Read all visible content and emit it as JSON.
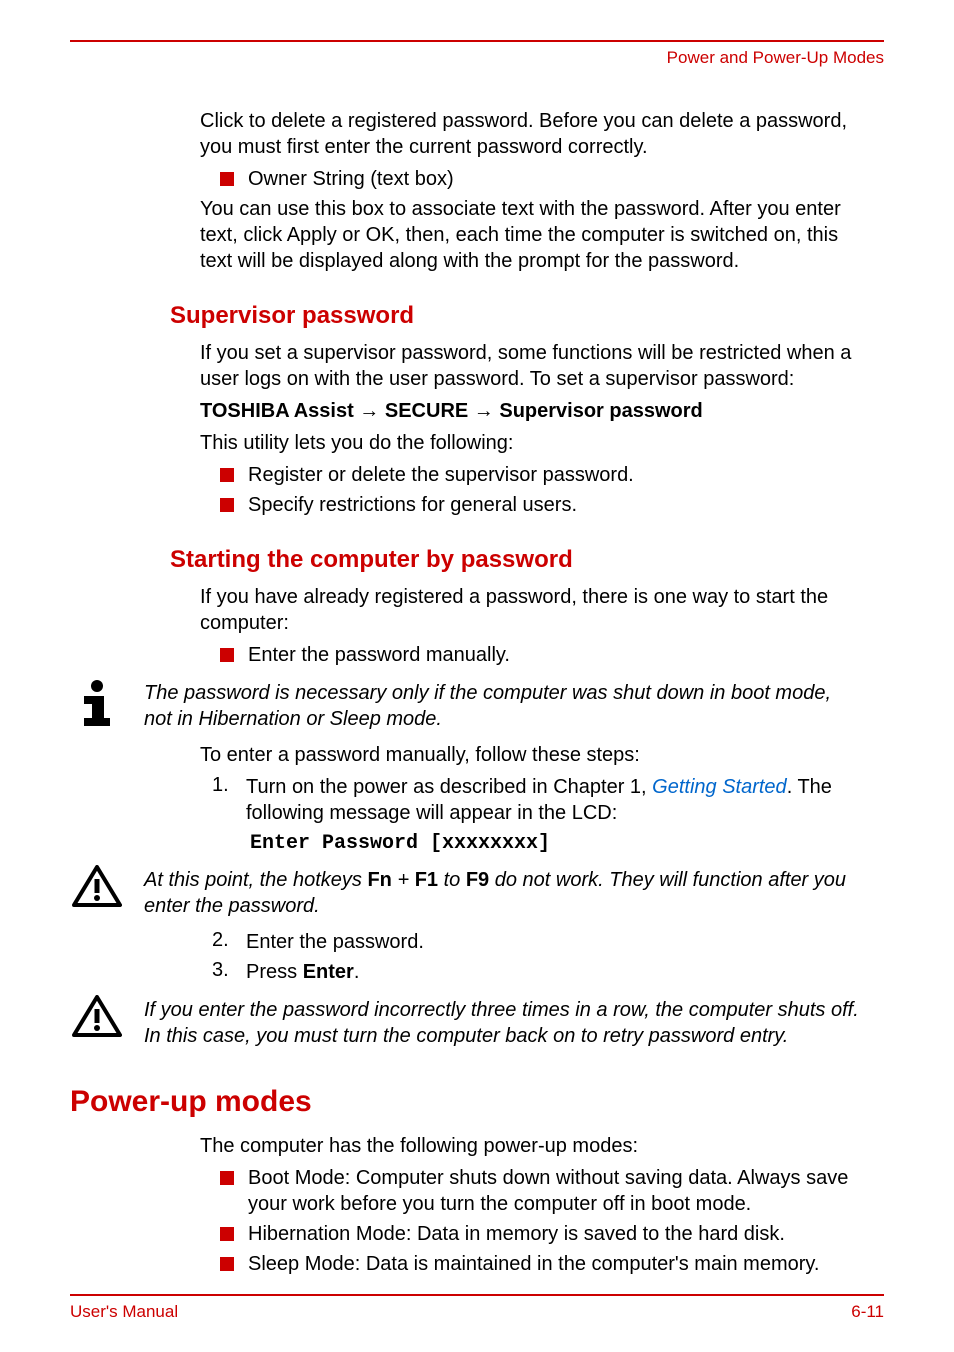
{
  "header": {
    "title": "Power and Power-Up Modes"
  },
  "intro": {
    "p1": "Click to delete a registered password. Before you can delete a password, you must first enter the current password correctly.",
    "b1": "Owner String (text box)",
    "p2": "You can use this box to associate text with the password. After you enter text, click Apply or OK, then, each time the computer is switched on, this text will be displayed along with the prompt for the password."
  },
  "supervisor": {
    "heading": "Supervisor password",
    "p1": "If you set a supervisor password, some functions will be restricted when a user logs on with the user password. To set a supervisor password:",
    "path_a": "TOSHIBA Assist",
    "arrow": " → ",
    "path_b": "SECURE",
    "path_c": "Supervisor password",
    "p2": "This utility lets you do the following:",
    "b1": "Register or delete the supervisor password.",
    "b2": "Specify restrictions for general users."
  },
  "starting": {
    "heading": "Starting the computer by password",
    "p1": "If you have already registered a password, there is one way to start the computer:",
    "b1": "Enter the password manually.",
    "note1": "The password is necessary only if the computer was shut down in boot mode, not in Hibernation or Sleep mode.",
    "p2": "To enter a password manually, follow these steps:",
    "ol1_pre": "Turn on the power as described in Chapter 1, ",
    "ol1_link": "Getting Started",
    "ol1_post": ". The following message will appear in the LCD:",
    "code": "Enter Password [xxxxxxxx]",
    "note2_pre": "At this point, the hotkeys ",
    "note2_fn": "Fn",
    "note2_plus": " + ",
    "note2_f1": "F1",
    "note2_to": " to ",
    "note2_f9": "F9",
    "note2_post": " do not work. They will function after you enter the password.",
    "ol2": "Enter the password.",
    "ol3_pre": "Press ",
    "ol3_enter": "Enter",
    "ol3_post": ".",
    "note3": "If you enter the password incorrectly three times in a row, the computer shuts off. In this case, you must turn the computer back on to retry password entry."
  },
  "powerup": {
    "heading": "Power-up modes",
    "p1": "The computer has the following power-up modes:",
    "b1": "Boot Mode: Computer shuts down without saving data. Always save your work before you turn the computer off in boot mode.",
    "b2": "Hibernation Mode: Data in memory is saved to the hard disk.",
    "b3": "Sleep Mode: Data is maintained in the computer's main memory."
  },
  "footer": {
    "left": "User's Manual",
    "right": "6-11"
  }
}
